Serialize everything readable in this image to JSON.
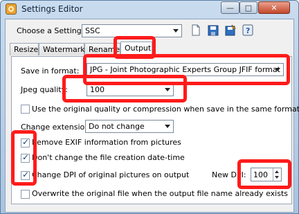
{
  "window": {
    "title": "Settings Editor",
    "buttons": {
      "minimize": "—",
      "maximize": "□",
      "close": "✕"
    }
  },
  "toolbar": {
    "choose_label": "Choose a Settings:",
    "choose_value": "SSC",
    "icons": [
      "new-icon",
      "save-icon",
      "save-as-icon",
      "help-icon"
    ]
  },
  "tabs": [
    {
      "label": "Resize",
      "active": false
    },
    {
      "label": "Watermark",
      "active": false
    },
    {
      "label": "Rename",
      "active": false
    },
    {
      "label": "Output",
      "active": true
    }
  ],
  "output": {
    "save_format_label": "Save in format:",
    "save_format_value": "JPG - Joint Photographic Experts Group JFIF format",
    "jpeg_quality_label": "Jpeg quality:",
    "jpeg_quality_value": "100",
    "use_original_quality_label": "Use the original quality or compression when save in the same format",
    "use_original_quality_checked": false,
    "change_extension_label": "Change extension:",
    "change_extension_value": "Do not change",
    "remove_exif_label": "Remove EXIF information from pictures",
    "remove_exif_checked": true,
    "keep_date_label": "Don't change the file creation date-time",
    "keep_date_checked": true,
    "change_dpi_label": "Change DPI of original pictures on output",
    "change_dpi_checked": true,
    "new_dpi_label": "New DPI:",
    "new_dpi_value": "100",
    "overwrite_label": "Overwrite the original file when the output file name already exists",
    "overwrite_checked": false
  },
  "colors": {
    "highlight": "#ff1b1b",
    "window_frame": "#a9c3df"
  }
}
